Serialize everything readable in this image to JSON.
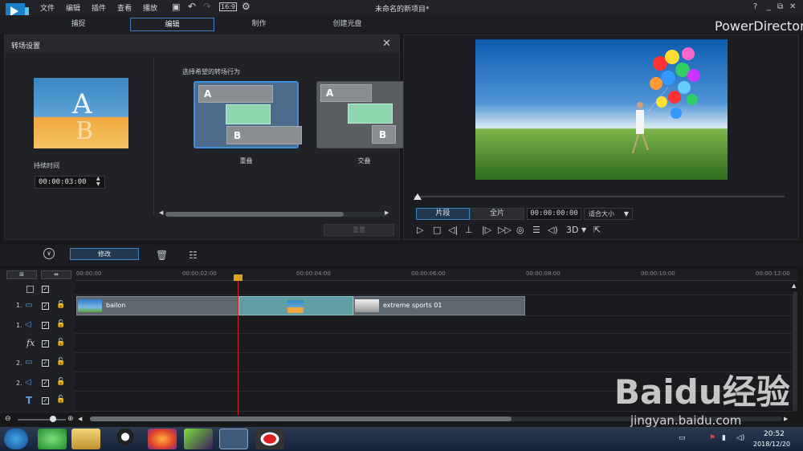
{
  "menu": [
    "文件",
    "编辑",
    "插件",
    "查看",
    "播放"
  ],
  "window_title": "未命名的新项目*",
  "window_controls": [
    "?",
    "_",
    "⧉",
    "✕"
  ],
  "tabs": [
    "捕捉",
    "编辑",
    "制作",
    "创建光盘"
  ],
  "brand": "PowerDirector",
  "transition_panel": {
    "title": "转场设置",
    "duration_label": "持续时间",
    "duration_value": "00:00:03:00",
    "behavior_label": "选择希望的转场行为",
    "options": [
      {
        "label": "重叠",
        "a": "A",
        "b": "B"
      },
      {
        "label": "交叠",
        "a": "A",
        "b": "B"
      }
    ],
    "apply_label": "重置"
  },
  "preview": {
    "mode_clip": "片段",
    "mode_movie": "全片",
    "timecode": "00:00:00:00",
    "fit": "适合大小",
    "three_d": "3D"
  },
  "toolbar": {
    "modify": "修改"
  },
  "ruler": [
    "00:00:00",
    "00:00:02:00",
    "00:00:04:00",
    "00:00:06:00",
    "00:00:08:00",
    "00:00:10:00",
    "00:00:12:00"
  ],
  "tracks": [
    {
      "num": "",
      "icon": "master"
    },
    {
      "num": "1.",
      "icon": "video"
    },
    {
      "num": "1.",
      "icon": "audio"
    },
    {
      "num": "",
      "icon": "fx"
    },
    {
      "num": "2.",
      "icon": "video"
    },
    {
      "num": "2.",
      "icon": "audio"
    },
    {
      "num": "",
      "icon": "title"
    }
  ],
  "clips": [
    {
      "name": "ballon"
    },
    {
      "name": "extreme sports 01"
    }
  ],
  "taskbar": {
    "time": "20:52",
    "date": "2018/12/20"
  },
  "watermark": {
    "text": "Baidu经验",
    "url": "jingyan.baidu.com"
  },
  "colors": {
    "accent": "#3d82c7",
    "playhead": "#d02020",
    "clip": "#5f9ea5"
  }
}
